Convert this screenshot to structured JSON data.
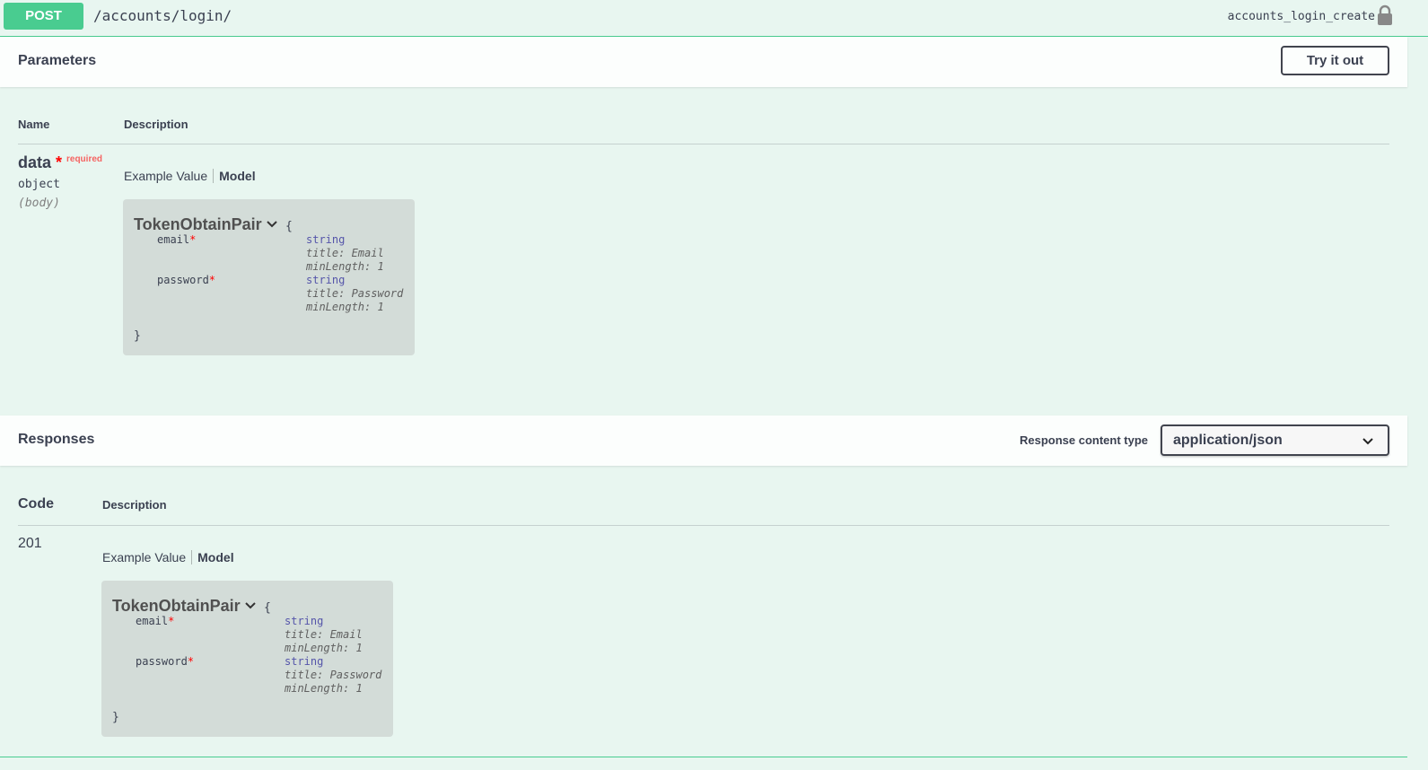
{
  "operation": {
    "method": "POST",
    "path": "/accounts/login/",
    "operation_id": "accounts_login_create",
    "lock_icon": "lock-icon"
  },
  "parameters": {
    "title": "Parameters",
    "try_it_out_label": "Try it out",
    "columns": {
      "name": "Name",
      "description": "Description"
    },
    "param": {
      "name": "data",
      "required_star": "*",
      "required_label": "required",
      "type": "object",
      "in": "(body)"
    },
    "tabs": {
      "example": "Example Value",
      "model": "Model"
    }
  },
  "model": {
    "title": "TokenObtainPair",
    "open_brace": "{",
    "close_brace": "}",
    "properties": [
      {
        "name": "email",
        "star": "*",
        "type": "string",
        "title": "title: Email",
        "min_length": "minLength: 1"
      },
      {
        "name": "password",
        "star": "*",
        "type": "string",
        "title": "title: Password",
        "min_length": "minLength: 1"
      }
    ]
  },
  "responses": {
    "title": "Responses",
    "content_type_label": "Response content type",
    "content_type_value": "application/json",
    "columns": {
      "code": "Code",
      "description": "Description"
    },
    "rows": [
      {
        "code": "201"
      }
    ],
    "tabs": {
      "example": "Example Value",
      "model": "Model"
    }
  },
  "colors": {
    "post_green": "#49cc90",
    "block_bg": "#e8f6f0",
    "model_bg": "#d3dcd8",
    "required_red": "#ff0000"
  }
}
